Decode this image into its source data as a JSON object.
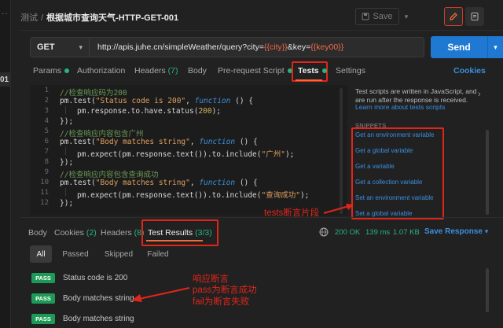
{
  "sidebar": {
    "collapsed_marker": "··",
    "active_number": "01"
  },
  "header": {
    "breadcrumb_parent": "测试",
    "breadcrumb_sep": "/",
    "request_title": "根据城市查询天气-HTTP-GET-001",
    "save_label": "Save"
  },
  "request": {
    "method": "GET",
    "url_prefix": "http://apis.juhe.cn/simpleWeather/query?city=",
    "url_var_city": "{{city}}",
    "url_mid": "&key=",
    "url_var_key": "{{key00}}",
    "send_label": "Send"
  },
  "tabs": {
    "params": "Params",
    "authorization": "Authorization",
    "headers": "Headers",
    "headers_count": "(7)",
    "body": "Body",
    "prerequest": "Pre-request Script",
    "tests": "Tests",
    "settings": "Settings",
    "cookies": "Cookies"
  },
  "editor": {
    "lines": [
      {
        "n": "1",
        "text": "//检查响应码为200"
      },
      {
        "n": "2",
        "text": ""
      },
      {
        "n": "3",
        "text": ""
      },
      {
        "n": "4",
        "text": "});"
      },
      {
        "n": "5",
        "text": "//检查响应内容包含广州"
      },
      {
        "n": "6",
        "text": ""
      },
      {
        "n": "7",
        "text": ""
      },
      {
        "n": "8",
        "text": "});"
      },
      {
        "n": "9",
        "text": "//检查响应内容包含查询成功"
      },
      {
        "n": "10",
        "text": ""
      },
      {
        "n": "11",
        "text": ""
      },
      {
        "n": "12",
        "text": "});"
      }
    ],
    "l2_a": "pm.test(",
    "l2_str": "\"Status code is 200\"",
    "l2_b": ", ",
    "l2_kw": "function",
    "l2_c": " () {",
    "l3_a": "pm.response.to.have.status(",
    "l3_num": "200",
    "l3_b": ");",
    "l6_a": "pm.test(",
    "l6_str": "\"Body matches string\"",
    "l6_b": ", ",
    "l6_kw": "function",
    "l6_c": " () {",
    "l7_a": "pm.expect(pm.response.text()).to.include(",
    "l7_str": "\"广州\"",
    "l7_b": ");",
    "l10_a": "pm.test(",
    "l10_str": "\"Body matches string\"",
    "l10_b": ", ",
    "l10_kw": "function",
    "l10_c": " () {",
    "l11_a": "pm.expect(pm.response.text()).to.include(",
    "l11_str": "\"查询成功\"",
    "l11_b": ");"
  },
  "snippets_panel": {
    "description": "Test scripts are written in JavaScript, and are run after the response is received.",
    "learn_more": "Learn more about tests scripts",
    "heading": "SNIPPETS",
    "items": [
      "Get an environment variable",
      "Get a global variable",
      "Get a variable",
      "Get a collection variable",
      "Set an environment variable",
      "Set a global variable"
    ]
  },
  "annotations": {
    "tests_snippets": "tests断言片段",
    "response_assert_1": "响应断言",
    "response_assert_2": "pass为断言成功",
    "response_assert_3": "fail为断言失败"
  },
  "response": {
    "tabs": {
      "body": "Body",
      "cookies": "Cookies",
      "cookies_count": "(2)",
      "headers": "Headers",
      "headers_count": "(8)",
      "test_results": "Test Results",
      "test_results_count": "(3/3)"
    },
    "status": "200 OK",
    "time": "139 ms",
    "size": "1.07 KB",
    "save_response": "Save Response",
    "filters": [
      "All",
      "Passed",
      "Skipped",
      "Failed"
    ],
    "results": [
      {
        "badge": "PASS",
        "name": "Status code is 200"
      },
      {
        "badge": "PASS",
        "name": "Body matches string"
      },
      {
        "badge": "PASS",
        "name": "Body matches string"
      }
    ]
  },
  "colors": {
    "accent_orange": "#f26b3a",
    "link_blue": "#3a8fe0",
    "send_blue": "#1f78d1",
    "success_green": "#26b47f",
    "annotation_red": "#e0261b"
  }
}
